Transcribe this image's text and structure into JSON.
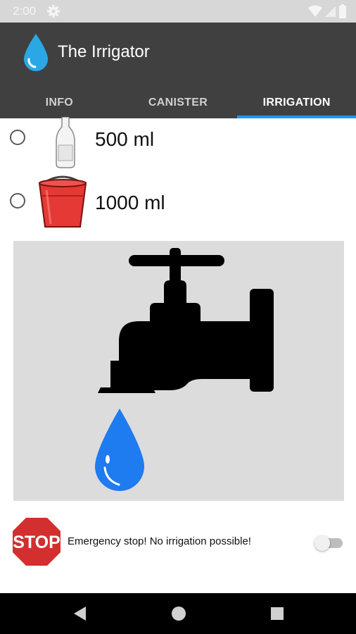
{
  "status_bar": {
    "time": "2:00",
    "icons": [
      "settings-icon",
      "wifi-icon",
      "signal-icon",
      "battery-icon"
    ]
  },
  "app_bar": {
    "title": "The Irrigator",
    "logo_icon": "water-drop-icon",
    "tabs": [
      {
        "label": "INFO",
        "active": false
      },
      {
        "label": "CANISTER",
        "active": false
      },
      {
        "label": "IRRIGATION",
        "active": true
      }
    ],
    "indicator_color": "#2196f3",
    "background": "#404040"
  },
  "options": [
    {
      "label": "500 ml",
      "icon": "bottle-icon",
      "selected": false
    },
    {
      "label": "1000 ml",
      "icon": "bucket-icon",
      "selected": false
    }
  ],
  "tap_panel": {
    "icon": "water-tap-icon",
    "drop_icon": "water-drop-icon",
    "drop_color": "#1e7bf0"
  },
  "emergency": {
    "sign_text": "STOP",
    "message": "Emergency stop! No irrigation possible!",
    "switch_on": false
  },
  "nav_bar": {
    "buttons": [
      "back-icon",
      "home-icon",
      "recents-icon"
    ]
  }
}
